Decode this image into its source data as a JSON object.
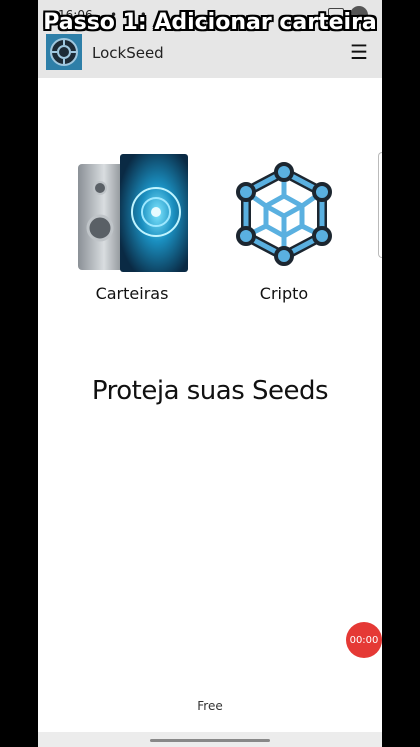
{
  "overlay": {
    "caption": "Passo 1: Adicionar carteira"
  },
  "statusbar": {
    "time": "16:06",
    "dots": "• • •"
  },
  "app": {
    "title": "LockSeed",
    "menu_icon": "hamburger-icon",
    "logo_icon": "vault-logo-icon"
  },
  "cards": [
    {
      "label": "Carteiras",
      "icon": "vault-safe-icon"
    },
    {
      "label": "Cripto",
      "icon": "crypto-network-icon"
    }
  ],
  "headline": "Proteja suas Seeds",
  "timer": "00:00",
  "plan": "Free",
  "colors": {
    "accent": "#2e7fa8",
    "crypto_blue": "#5ab0e0",
    "timer_red": "#e53935"
  }
}
